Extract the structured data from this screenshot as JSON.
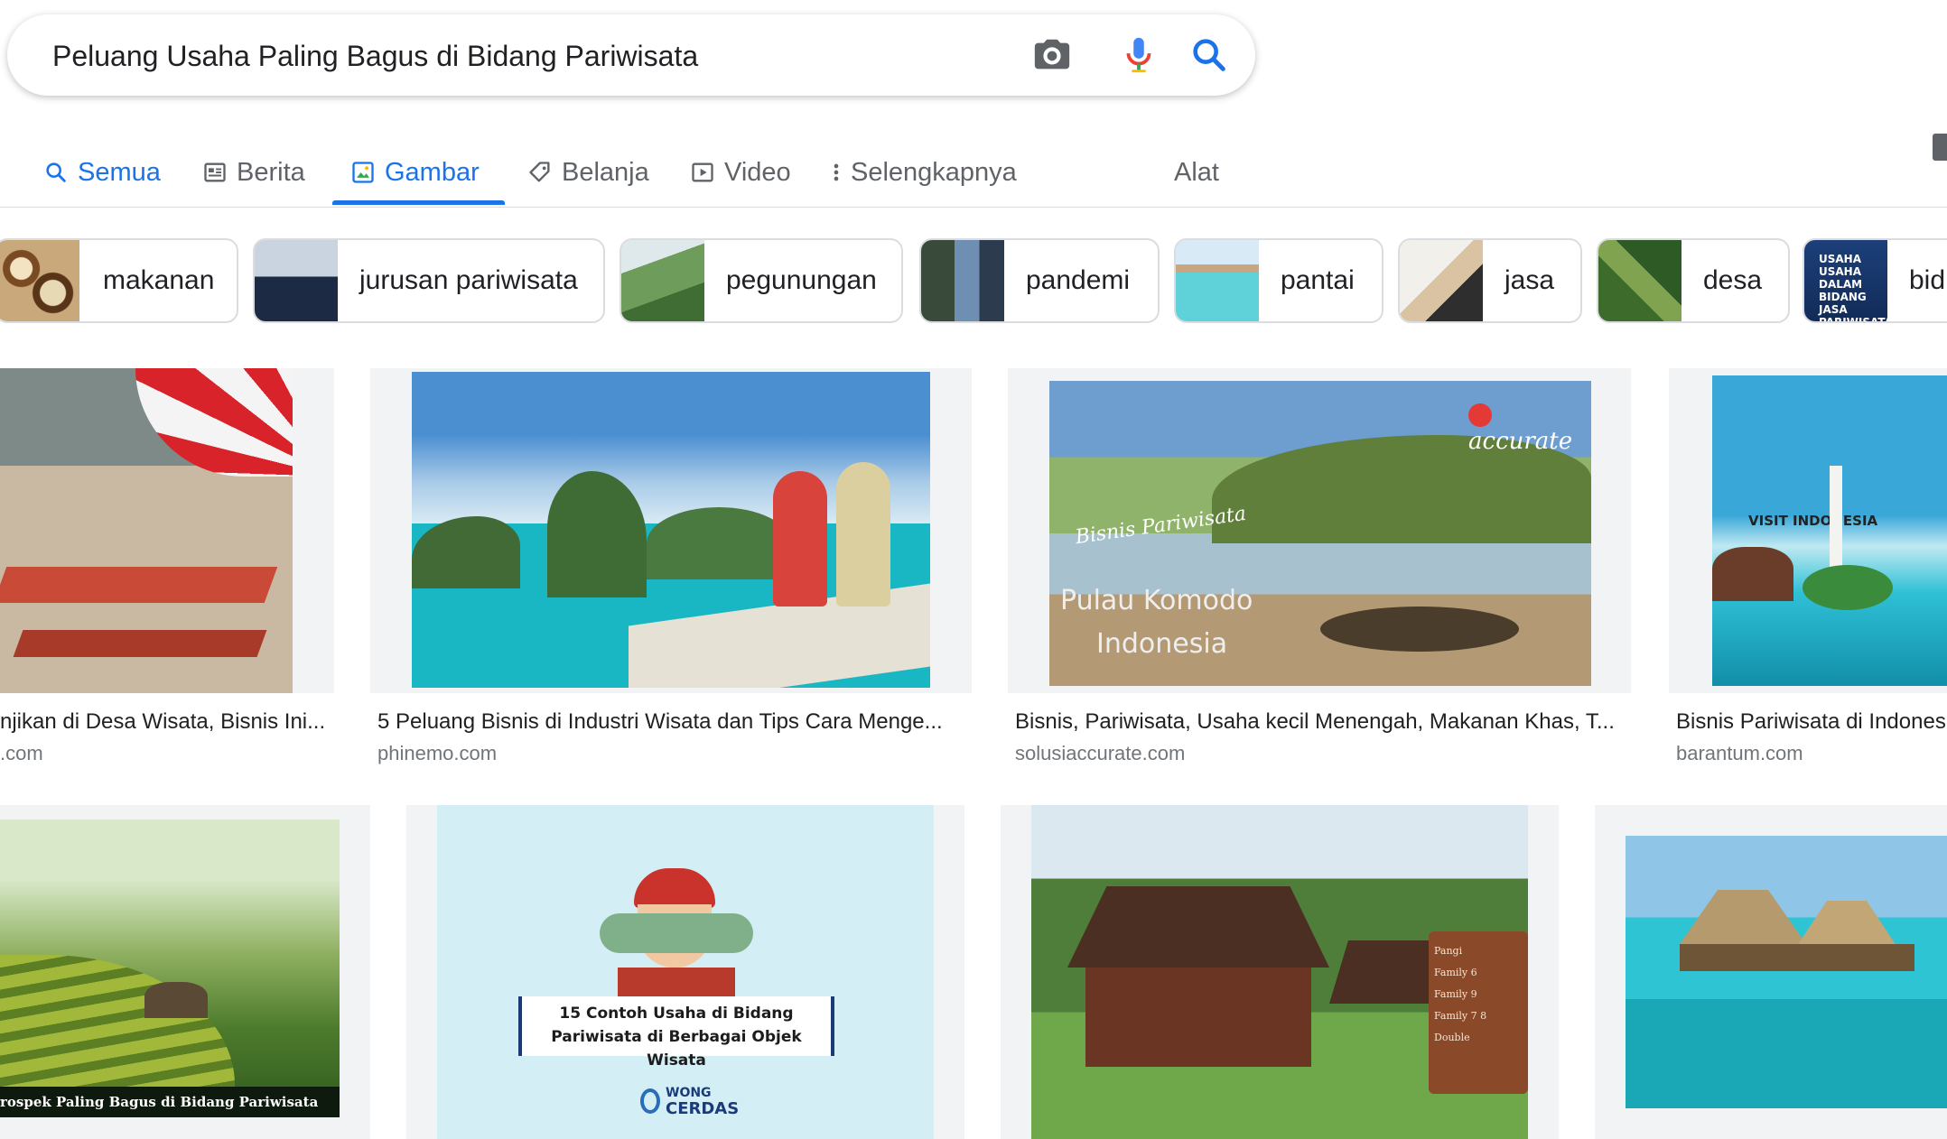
{
  "search": {
    "query": "Peluang Usaha Paling Bagus di Bidang Pariwisata"
  },
  "tabs": [
    {
      "label": "Semua",
      "icon": "search-icon"
    },
    {
      "label": "Berita",
      "icon": "news-icon"
    },
    {
      "label": "Gambar",
      "icon": "image-icon",
      "active": true
    },
    {
      "label": "Belanja",
      "icon": "tag-icon"
    },
    {
      "label": "Video",
      "icon": "video-icon"
    },
    {
      "label": "Selengkapnya",
      "icon": "more-vert-icon"
    },
    {
      "label": "Alat"
    }
  ],
  "chips": [
    "makanan",
    "jurusan pariwisata",
    "pegunungan",
    "pandemi",
    "pantai",
    "jasa",
    "desa",
    "bid"
  ],
  "chip_thumb_text": "USAHA USAHA DALAM BIDANG JASA PARIWISATA",
  "results": [
    {
      "caption": "njikan di Desa Wisata, Bisnis Ini...",
      "source": ".com"
    },
    {
      "caption": "5 Peluang Bisnis di Industri Wisata dan Tips Cara Menge...",
      "source": "phinemo.com"
    },
    {
      "caption": "Bisnis, Pariwisata, Usaha kecil Menengah, Makanan Khas, T...",
      "source": "solusiaccurate.com",
      "overlay": {
        "brand": "accurate",
        "script": "Bisnis Pariwisata",
        "line1": "Pulau Komodo",
        "line2": "Indonesia"
      }
    },
    {
      "caption": "Bisnis Pariwisata di Indones",
      "source": "barantum.com",
      "overlay": {
        "title": "VISIT INDONESIA"
      }
    },
    {
      "overlay": {
        "text": "rospek Paling Bagus di Bidang Pariwisata"
      }
    },
    {
      "overlay": {
        "line1": "15 Contoh Usaha di Bidang",
        "line2": "Pariwisata di Berbagai Objek Wisata",
        "brand_a": "WONG",
        "brand_b": "CERDAS"
      }
    },
    {
      "overlay": {
        "signs": [
          "Pangi",
          "Family 6",
          "Family 9",
          "Family 7 8",
          "Double"
        ]
      }
    },
    {}
  ],
  "colors": {
    "accent": "#1a73e8",
    "muted": "#5f6368",
    "border": "#dadce0"
  }
}
